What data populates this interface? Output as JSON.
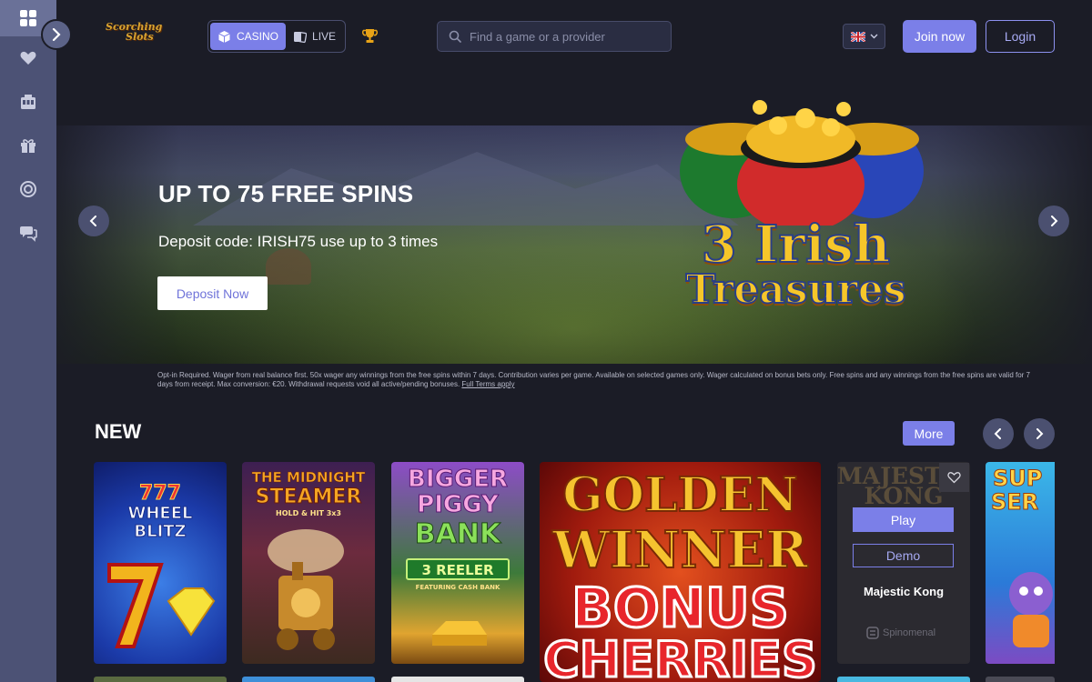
{
  "header": {
    "logo_line1": "Scorching",
    "logo_line2": "Slots",
    "mode_casino": "CASINO",
    "mode_live": "LIVE",
    "search_placeholder": "Find a game or a provider",
    "join_label": "Join now",
    "login_label": "Login"
  },
  "sidebar": {
    "items": [
      "home",
      "favorites",
      "casino",
      "promotions",
      "vip",
      "support"
    ]
  },
  "banner": {
    "title": "UP TO 75 FREE SPINS",
    "subtitle": "Deposit code: IRISH75 use up to 3 times",
    "button_label": "Deposit Now",
    "game_logo_line1": "3 Irish",
    "game_logo_line2": "Treasures",
    "terms": "Opt-in Required. Wager from real balance first. 50x wager any winnings from the free spins within 7 days. Contribution varies per game. Available on selected games only. Wager calculated on bonus bets only. Free spins and any winnings from the free spins are valid for 7 days from receipt. Max conversion: €20. Withdrawal requests void all active/pending bonuses.",
    "terms_link": "Full Terms apply"
  },
  "new_section": {
    "title": "NEW",
    "more_label": "More",
    "games": [
      {
        "art_line1": "777",
        "art_line2": "WHEEL",
        "art_line3": "BLITZ"
      },
      {
        "art_line1": "THE MIDNIGHT",
        "art_line2": "STEAMER",
        "art_line3": "HOLD & HIT 3x3"
      },
      {
        "art_line1": "BIGGER",
        "art_line2": "PIGGY",
        "art_line3": "BANK",
        "art_line4": "3 REELER",
        "art_line5": "FEATURING CASH BANK"
      },
      {
        "art_line1": "GOLDEN",
        "art_line2": "WINNER",
        "art_line3": "BONUS",
        "art_line4": "CHERRIES"
      },
      {
        "art_line1": "MAJESTIC",
        "art_line2": "KONG",
        "name": "Majestic Kong",
        "play_label": "Play",
        "demo_label": "Demo",
        "provider": "Spinomenal"
      },
      {
        "art_line1": "SUP",
        "art_line2": "SER"
      }
    ]
  },
  "colors": {
    "accent": "#7b7fe8",
    "background": "#1b1c26",
    "sidebar": "#4c5275"
  }
}
